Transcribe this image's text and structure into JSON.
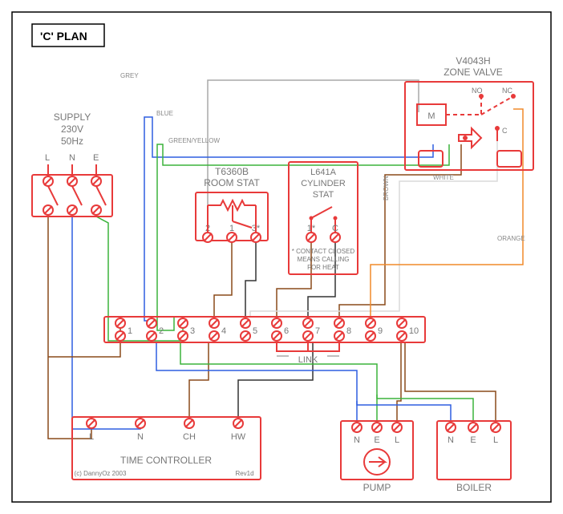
{
  "title": "'C' PLAN",
  "supply": {
    "label": "SUPPLY",
    "voltage": "230V",
    "freq": "50Hz",
    "terminals": [
      "L",
      "N",
      "E"
    ]
  },
  "roomStat": {
    "model": "T6360B",
    "name": "ROOM STAT",
    "terminals": [
      "2",
      "1",
      "3*"
    ]
  },
  "cylinderStat": {
    "model": "L641A",
    "name": "CYLINDER",
    "name2": "STAT",
    "terminals": [
      "1*",
      "C"
    ],
    "note1": "* CONTACT CLOSED",
    "note2": "MEANS CALLING",
    "note3": "FOR HEAT"
  },
  "zoneValve": {
    "model": "V4043H",
    "name": "ZONE VALVE",
    "M": "M",
    "NO": "NO",
    "NC": "NC",
    "C": "C"
  },
  "junction": {
    "terminals": [
      "1",
      "2",
      "3",
      "4",
      "5",
      "6",
      "7",
      "8",
      "9",
      "10"
    ],
    "link": "LINK"
  },
  "timeController": {
    "name": "TIME CONTROLLER",
    "terminals": [
      "L",
      "N",
      "CH",
      "HW"
    ],
    "copyright": "(c) DannyOz 2003",
    "rev": "Rev1d"
  },
  "pump": {
    "name": "PUMP",
    "terminals": [
      "N",
      "E",
      "L"
    ]
  },
  "boiler": {
    "name": "BOILER",
    "terminals": [
      "N",
      "E",
      "L"
    ]
  },
  "wires": {
    "grey": "GREY",
    "blue": "BLUE",
    "greenyellow": "GREEN/YELLOW",
    "brown": "BROWN",
    "white": "WHITE",
    "orange": "ORANGE"
  }
}
